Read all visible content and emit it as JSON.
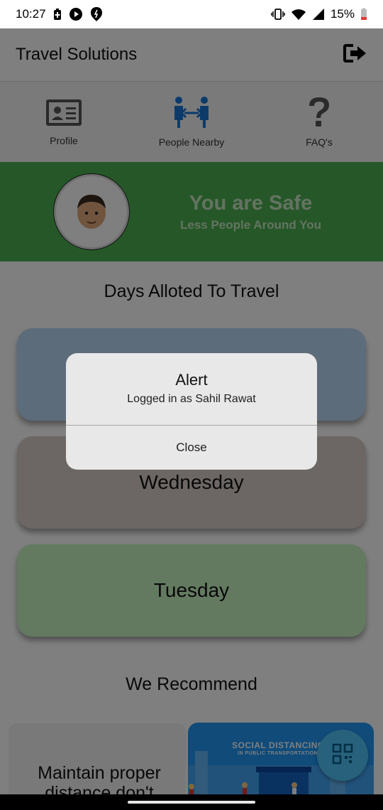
{
  "status_bar": {
    "time": "10:27",
    "battery_percent": "15%",
    "icons": [
      "battery-saver-icon",
      "play-icon",
      "notification-icon",
      "vibrate-icon",
      "wifi-icon",
      "signal-icon",
      "battery-icon"
    ]
  },
  "app_bar": {
    "title": "Travel Solutions",
    "logout_icon": "logout-icon"
  },
  "tabs": [
    {
      "label": "Profile",
      "icon": "id-card-icon"
    },
    {
      "label": "People Nearby",
      "icon": "people-distance-icon"
    },
    {
      "label": "FAQ's",
      "icon": "question-icon"
    }
  ],
  "safety_banner": {
    "title": "You are Safe",
    "subtitle": "Less People Around You",
    "color": "#4caf50"
  },
  "days_section": {
    "title": "Days Alloted To Travel",
    "days": [
      {
        "label": "",
        "color": "#b8d8f6"
      },
      {
        "label": "Wednesday",
        "color": "#d9cec8"
      },
      {
        "label": "Tuesday",
        "color": "#c7f4c3"
      }
    ]
  },
  "recommend_section": {
    "title": "We Recommend",
    "card_text": "Maintain proper distance don't",
    "image_title": "SOCIAL DISTANCING",
    "image_subtitle": "IN PUBLIC TRANSPORTATION"
  },
  "fab": {
    "icon": "qr-code-icon"
  },
  "alert": {
    "title": "Alert",
    "message": "Logged in as Sahil Rawat",
    "button": "Close"
  }
}
